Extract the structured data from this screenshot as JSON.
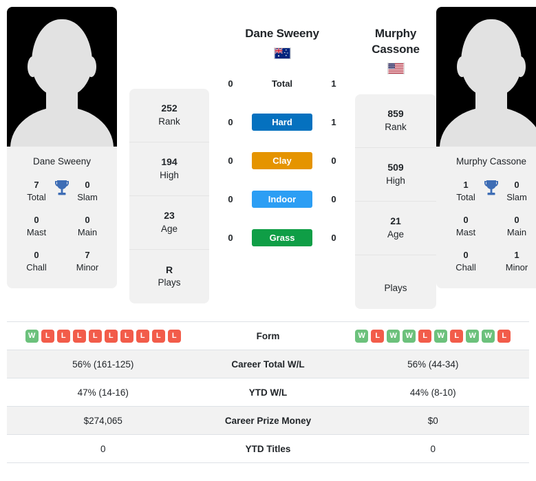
{
  "players": {
    "left": {
      "name": "Dane Sweeny",
      "photo_caption": "Dane Sweeny",
      "flag": "australia-flag",
      "titles": {
        "total_val": "7",
        "total_lab": "Total",
        "slam_val": "0",
        "slam_lab": "Slam",
        "mast_val": "0",
        "mast_lab": "Mast",
        "main_val": "0",
        "main_lab": "Main",
        "chall_val": "0",
        "chall_lab": "Chall",
        "minor_val": "7",
        "minor_lab": "Minor"
      },
      "ranks": [
        {
          "value": "252",
          "label": "Rank"
        },
        {
          "value": "194",
          "label": "High"
        },
        {
          "value": "23",
          "label": "Age"
        },
        {
          "value": "R",
          "label": "Plays"
        }
      ],
      "form": [
        "W",
        "L",
        "L",
        "L",
        "L",
        "L",
        "L",
        "L",
        "L",
        "L"
      ],
      "career_wl": "56% (161-125)",
      "ytd_wl": "47% (14-16)",
      "career_prize": "$274,065",
      "ytd_titles": "0"
    },
    "right": {
      "name": "Murphy Cassone",
      "photo_caption": "Murphy Cassone",
      "flag": "usa-flag",
      "titles": {
        "total_val": "1",
        "total_lab": "Total",
        "slam_val": "0",
        "slam_lab": "Slam",
        "mast_val": "0",
        "mast_lab": "Mast",
        "main_val": "0",
        "main_lab": "Main",
        "chall_val": "0",
        "chall_lab": "Chall",
        "minor_val": "1",
        "minor_lab": "Minor"
      },
      "ranks": [
        {
          "value": "859",
          "label": "Rank"
        },
        {
          "value": "509",
          "label": "High"
        },
        {
          "value": "21",
          "label": "Age"
        },
        {
          "value": "",
          "label": "Plays"
        }
      ],
      "form": [
        "W",
        "L",
        "W",
        "W",
        "L",
        "W",
        "L",
        "W",
        "W",
        "L"
      ],
      "career_wl": "56% (44-34)",
      "ytd_wl": "44% (8-10)",
      "career_prize": "$0",
      "ytd_titles": "0"
    }
  },
  "head_to_head": [
    {
      "label": "Total",
      "left": "0",
      "right": "1",
      "style": "plain",
      "color": ""
    },
    {
      "label": "Hard",
      "left": "0",
      "right": "1",
      "style": "pill",
      "color": "#0571bf"
    },
    {
      "label": "Clay",
      "left": "0",
      "right": "0",
      "style": "pill",
      "color": "#e59400"
    },
    {
      "label": "Indoor",
      "left": "0",
      "right": "0",
      "style": "pill",
      "color": "#2c9ef4"
    },
    {
      "label": "Grass",
      "left": "0",
      "right": "0",
      "style": "pill",
      "color": "#0f9e46"
    }
  ],
  "stats_rows": [
    {
      "label": "Form",
      "type": "form"
    },
    {
      "label": "Career Total W/L",
      "type": "text",
      "key": "career_wl"
    },
    {
      "label": "YTD W/L",
      "type": "text",
      "key": "ytd_wl"
    },
    {
      "label": "Career Prize Money",
      "type": "text",
      "key": "career_prize"
    },
    {
      "label": "YTD Titles",
      "type": "text",
      "key": "ytd_titles"
    }
  ],
  "colors": {
    "hard": "#0571bf",
    "clay": "#e59400",
    "indoor": "#2c9ef4",
    "grass": "#0f9e46",
    "win_badge": "#6cc17c",
    "loss_badge": "#f25c4a",
    "trophy": "#3e6db5"
  }
}
